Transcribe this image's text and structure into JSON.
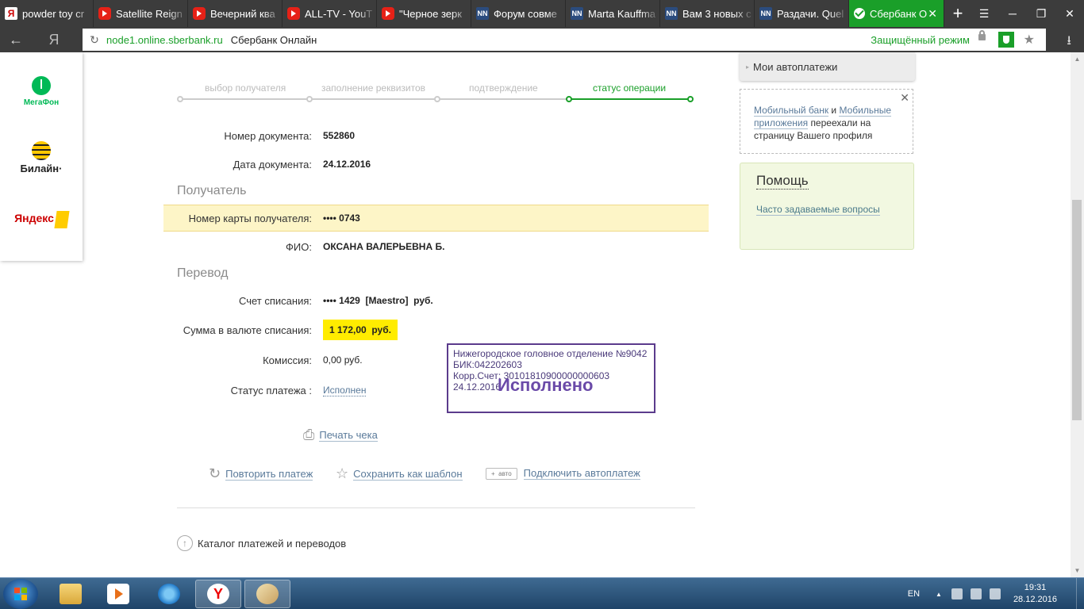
{
  "browser": {
    "tabs": [
      {
        "label": "powder toy cr",
        "icon": "yandex-favicon",
        "type": "ya"
      },
      {
        "label": "Satellite Reign",
        "icon": "youtube-favicon",
        "type": "yt"
      },
      {
        "label": "Вечерний ква",
        "icon": "youtube-favicon",
        "type": "yt"
      },
      {
        "label": "ALL-TV - YouT",
        "icon": "youtube-favicon",
        "type": "yt"
      },
      {
        "label": "\"Черное зерк",
        "icon": "youtube-favicon",
        "type": "yt"
      },
      {
        "label": "Форум совме",
        "icon": "nn-favicon",
        "type": "nn"
      },
      {
        "label": "Marta Kauffma",
        "icon": "nn-favicon",
        "type": "nn"
      },
      {
        "label": "Вам 3 новых с",
        "icon": "nn-favicon",
        "type": "nn"
      },
      {
        "label": "Раздачи. Quel",
        "icon": "nn-favicon",
        "type": "nn"
      },
      {
        "label": "Сбербанк О",
        "icon": "sberbank-favicon",
        "type": "sb",
        "active": true
      }
    ],
    "new_tab": "+",
    "nn_badge": "NN",
    "tab_close": "✕",
    "window_controls": [
      "☰",
      "─",
      "❐",
      "✕"
    ],
    "back": "←",
    "yandex_button": "Я",
    "reload": "↻",
    "address": {
      "domain": "node1.online.sberbank.ru",
      "page_title": "Сбербанк Онлайн",
      "secure_mode": "Защищённый режим"
    },
    "star": "★",
    "download": "⭳"
  },
  "sidebar": {
    "operators": [
      {
        "name": "МегаФон"
      },
      {
        "name": "Билайн"
      },
      {
        "name": "Яндекс"
      }
    ],
    "beeline_dot": "·"
  },
  "steps": [
    {
      "label": "выбор получателя",
      "active": false
    },
    {
      "label": "заполнение реквизитов",
      "active": false
    },
    {
      "label": "подтверждение",
      "active": false
    },
    {
      "label": "статус операции",
      "active": true
    }
  ],
  "document": {
    "number_label": "Номер документа:",
    "number": "552860",
    "date_label": "Дата документа:",
    "date": "24.12.2016"
  },
  "recipient": {
    "section_title": "Получатель",
    "card_label": "Номер карты получателя:",
    "card": "•••• 0743",
    "name_label": "ФИО:",
    "name": "ОКСАНА ВАЛЕРЬЕВНА Б."
  },
  "transfer": {
    "section_title": "Перевод",
    "account_label": "Счет списания:",
    "account": "•••• 1429  [Maestro]  руб.",
    "amount_label": "Сумма в валюте списания:",
    "amount": "1 172,00  руб.",
    "fee_label": "Комиссия:",
    "fee": "0,00 руб.",
    "status_label": "Статус платежа :",
    "status": "Исполнен"
  },
  "stamp": {
    "line1": "Нижегородское головное отделение №9042",
    "line2": "БИК:042202603",
    "line3": "Корр.Счет: 30101810900000000603",
    "big": "Исполнено",
    "date": "24.12.2016"
  },
  "actions": {
    "print": "Печать чека",
    "repeat": "Повторить платеж",
    "save_template": "Сохранить как шаблон",
    "auto_badge": "+  авто",
    "autopay": "Подключить автоплатеж",
    "catalog": "Каталог платежей и переводов"
  },
  "icons": {
    "print": "⎙",
    "repeat": "↻",
    "template": "☆",
    "catalog": "↑",
    "menu_arrow": "▸",
    "close": "✕",
    "scroll_up": "▲",
    "scroll_down": "▼"
  },
  "right_panel": {
    "autopay_menu": "Мои автоплатежи",
    "notice": {
      "link1": "Мобильный банк",
      "and": "и",
      "link2": "Мобильные приложения",
      "text": "переехали на страницу Вашего профиля"
    },
    "help": {
      "title": "Помощь",
      "faq": "Часто задаваемые вопросы"
    }
  },
  "taskbar": {
    "yandex_app": "Y",
    "tray_arrow": "▲",
    "lang": "EN",
    "time": "19:31",
    "date": "28.12.2016"
  },
  "colors": {
    "accent": "#1a9f29",
    "highlight_row": "#fdf5c7",
    "amount_bg": "#ffec00",
    "stamp": "#5b3b8c",
    "link": "#5a7a9a"
  }
}
